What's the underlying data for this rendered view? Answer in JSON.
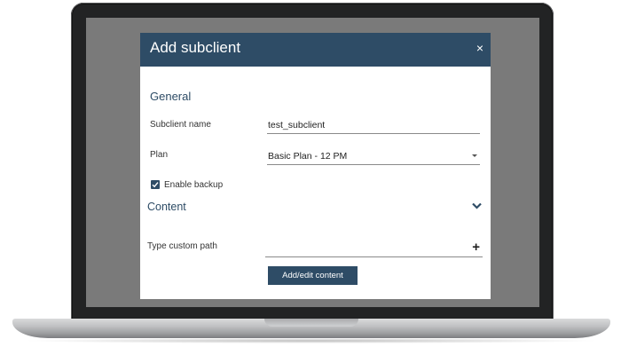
{
  "dialog": {
    "title": "Add subclient",
    "close_symbol": "×",
    "general_heading": "General",
    "subclient_name_label": "Subclient name",
    "subclient_name_value": "test_subclient",
    "plan_label": "Plan",
    "plan_value": "Basic Plan - 12 PM",
    "enable_backup_label": "Enable backup",
    "enable_backup_checked": true,
    "content_heading": "Content",
    "custom_path_label": "Type custom path",
    "custom_path_value": "",
    "add_edit_button": "Add/edit content"
  },
  "colors": {
    "accent": "#2e4c66",
    "screen_backdrop": "#7a7a7a"
  },
  "icons": [
    "close-icon",
    "checkmark-icon",
    "chevron-down-icon",
    "plus-icon",
    "dropdown-caret-icon"
  ]
}
